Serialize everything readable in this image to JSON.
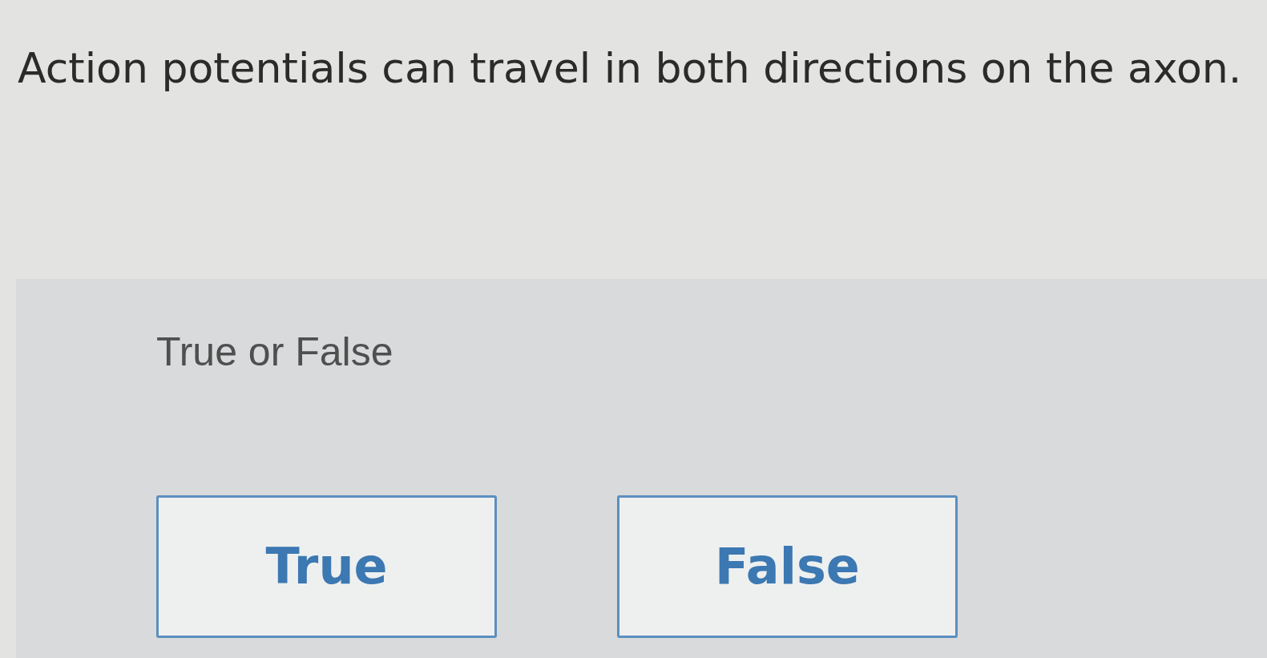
{
  "question": {
    "text": "Action potentials can travel in both directions on the axon."
  },
  "answer_panel": {
    "prompt": "True or False",
    "options": [
      {
        "label": "True",
        "selected": false
      },
      {
        "label": "False",
        "selected": false
      }
    ]
  }
}
